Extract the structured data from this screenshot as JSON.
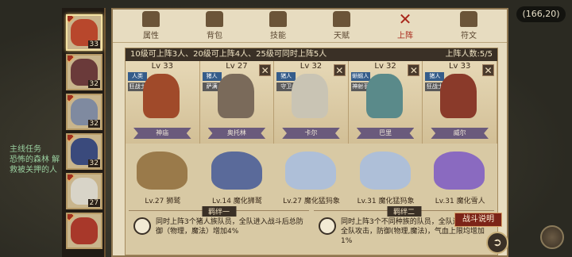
{
  "map": {
    "coordinates": "(166,20)",
    "quest_label": "主线任务",
    "quest_text": "恐怖的森林 解救被关押的人"
  },
  "tabs": [
    {
      "label": "属性"
    },
    {
      "label": "背包"
    },
    {
      "label": "技能"
    },
    {
      "label": "天赋"
    },
    {
      "label": "上阵",
      "selected": true
    },
    {
      "label": "符文"
    }
  ],
  "party": [
    {
      "level": "33",
      "color": "#b8472c",
      "active": true
    },
    {
      "level": "32",
      "color": "#6a3a3a"
    },
    {
      "level": "32",
      "color": "#7f8aa0"
    },
    {
      "level": "32",
      "color": "#3a4a7c"
    },
    {
      "level": "27",
      "color": "#d8d4c8"
    },
    {
      "level": "",
      "color": "#a8382a"
    }
  ],
  "rule_text": "10级可上阵3人、20级可上阵4人、25级可同时上阵5人",
  "deploy_count": "上阵人数:5/5",
  "heroes": [
    {
      "level": "Lv 33",
      "tags": [
        "人类",
        "狂战士"
      ],
      "name": "神庙",
      "color": "#a04a2a",
      "removable": false
    },
    {
      "level": "Lv 27",
      "tags": [
        "猪人",
        "萨满"
      ],
      "name": "奥托林",
      "color": "#7a6a5a",
      "removable": true
    },
    {
      "level": "Lv 32",
      "tags": [
        "猪人",
        "守卫"
      ],
      "name": "卡尔",
      "color": "#c9c4b4",
      "removable": true
    },
    {
      "level": "Lv 32",
      "tags": [
        "蜥蜴人",
        "神射手"
      ],
      "name": "巴里",
      "color": "#5a8a8a",
      "removable": true
    },
    {
      "level": "Lv 33",
      "tags": [
        "猪人",
        "狂战士"
      ],
      "name": "威尔",
      "color": "#8a3a2a",
      "removable": true
    }
  ],
  "mounts": [
    {
      "label": "Lv.27 狮鹫",
      "color": "#9a7a4a"
    },
    {
      "label": "Lv.14 魔化狮鹫",
      "color": "#5a6a9a"
    },
    {
      "label": "Lv.27 魔化猛犸象",
      "color": "#aebfd8"
    },
    {
      "label": "Lv.31 魔化猛犸象",
      "color": "#aebfd8"
    },
    {
      "label": "Lv.31 魔化雪人",
      "color": "#8a6ac0"
    }
  ],
  "bonds": [
    {
      "title": "羁绊一",
      "text": "同时上阵3个猪人族队员，全队进入战斗后总防御（物理，魔法）增加4%"
    },
    {
      "title": "羁绊二",
      "text": "同时上阵3个不同种族的队员，全队进入战斗后全队攻击，防御(物理,魔法)，气血上限均增加1%"
    }
  ],
  "battle_button": "战斗说明",
  "back_icon": "back-arrow-icon"
}
